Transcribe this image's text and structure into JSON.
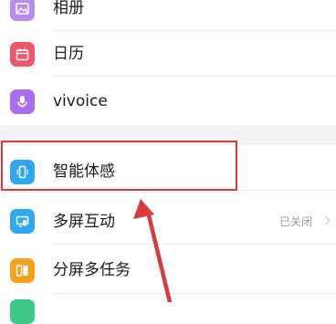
{
  "settings": {
    "items": [
      {
        "label": "相册",
        "icon": "photos-icon",
        "color": "#b98cf0"
      },
      {
        "label": "日历",
        "icon": "calendar-icon",
        "color": "#f0566a"
      },
      {
        "label": "vivoice",
        "icon": "microphone-icon",
        "color": "#a96ef0"
      },
      {
        "label": "智能体感",
        "icon": "phone-motion-icon",
        "color": "#2fa8f2"
      },
      {
        "label": "多屏互动",
        "icon": "screen-cast-icon",
        "color": "#2fa8f2",
        "value": "已关闭"
      },
      {
        "label": "分屏多任务",
        "icon": "split-screen-icon",
        "color": "#f5a020"
      }
    ]
  },
  "annotation": {
    "highlight_color": "#d93a3a",
    "arrow_color": "#d93a3a"
  }
}
